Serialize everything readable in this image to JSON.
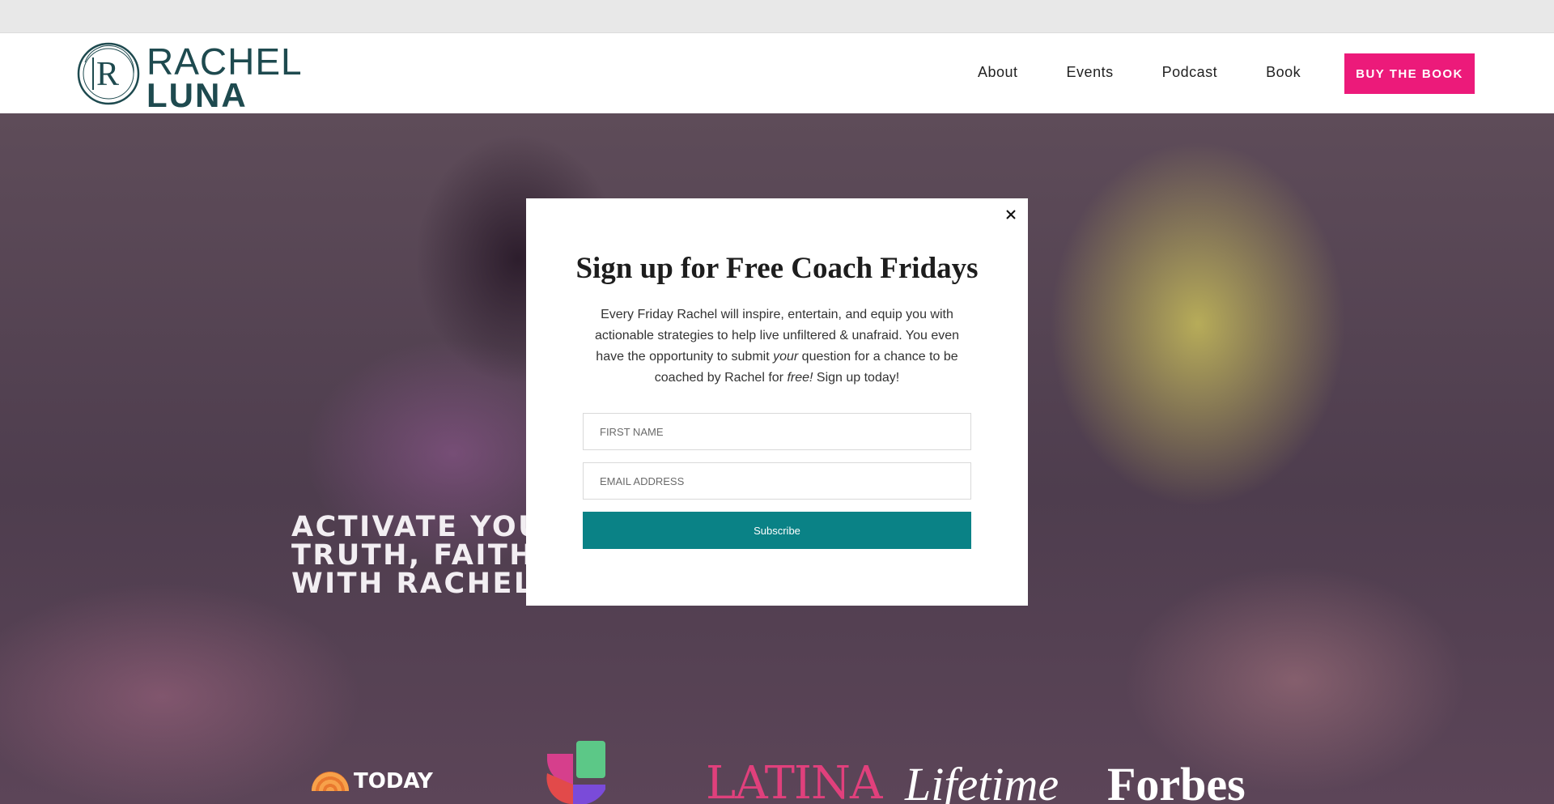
{
  "site": {
    "logo_line1": "RACHEL",
    "logo_line2": "LUNA",
    "brand_color": "#1e4a4f",
    "accent_color": "#ec1a7a"
  },
  "nav": {
    "items": [
      {
        "label": "About"
      },
      {
        "label": "Events"
      },
      {
        "label": "Podcast"
      },
      {
        "label": "Book"
      }
    ],
    "cta_label": "BUY THE BOOK"
  },
  "hero": {
    "title_lines": [
      "ACTIVATE YOUR",
      "TRUTH, FAITH & FREEDOM",
      "WITH RACHEL LUNA"
    ]
  },
  "press": {
    "logos": [
      {
        "label": "TODAY",
        "icon": "today-logo"
      },
      {
        "label": "",
        "icon": "univision-logo"
      },
      {
        "label": "LATINA",
        "icon": "latina-logo"
      },
      {
        "label": "Lifetime",
        "icon": "lifetime-logo"
      },
      {
        "label": "Forbes",
        "icon": "forbes-logo"
      }
    ]
  },
  "modal": {
    "title": "Sign up for Free Coach Fridays",
    "body_part1": "Every Friday Rachel will inspire, entertain, and equip you with actionable strategies to help live unfiltered & unafraid. You even have the opportunity to submit ",
    "body_em1": "your",
    "body_part2": " question for a chance to be coached by Rachel for ",
    "body_em2": "free!",
    "body_part3": " Sign up today!",
    "first_name_placeholder": "FIRST NAME",
    "email_placeholder": "EMAIL ADDRESS",
    "subscribe_label": "Subscribe",
    "subscribe_color": "#0a8286",
    "close_icon": "close-icon"
  }
}
